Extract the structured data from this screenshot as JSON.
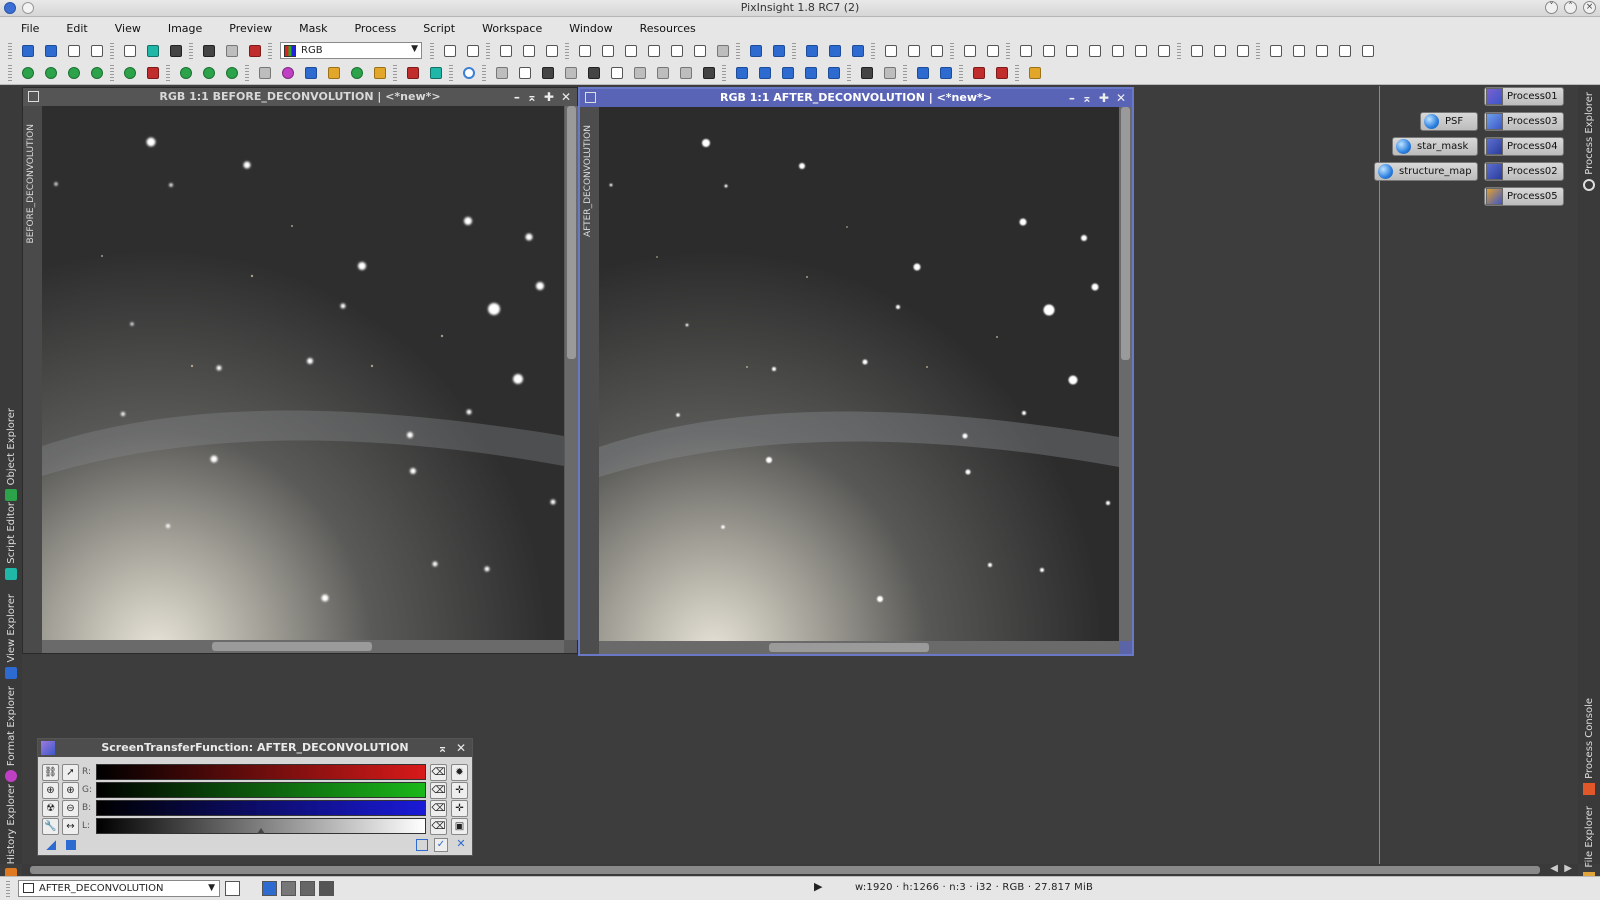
{
  "window": {
    "title": "PixInsight 1.8 RC7 (2)"
  },
  "menu": [
    "File",
    "Edit",
    "View",
    "Image",
    "Preview",
    "Mask",
    "Process",
    "Script",
    "Workspace",
    "Window",
    "Resources"
  ],
  "toolbar": {
    "channel_combo_value": "RGB"
  },
  "left_tabs": [
    "Object Explorer",
    "Script Editor",
    "View Explorer",
    "Format Explorer",
    "History Explorer"
  ],
  "right_tabs": [
    "Process Explorer",
    "Process Console",
    "File Explorer"
  ],
  "image_windows": [
    {
      "title": "RGB 1:1 BEFORE_DECONVOLUTION | <*new*>",
      "side_label": "BEFORE_DECONVOLUTION",
      "active": false
    },
    {
      "title": "RGB 1:1 AFTER_DECONVOLUTION | <*new*>",
      "side_label": "AFTER_DECONVOLUTION",
      "active": true
    }
  ],
  "process_icons": {
    "right_column": [
      "Process01",
      "Process03",
      "Process04",
      "Process02",
      "Process05"
    ],
    "image_icons": [
      "PSF",
      "star_mask",
      "structure_map"
    ]
  },
  "stf_panel": {
    "title": "ScreenTransferFunction: AFTER_DECONVOLUTION",
    "channels": [
      {
        "label": "R:",
        "color": "#d81a1a"
      },
      {
        "label": "G:",
        "color": "#1ab81a"
      },
      {
        "label": "B:",
        "color": "#1a1ad8"
      },
      {
        "label": "L:",
        "color": "#ffffff"
      }
    ],
    "luminance_midtone": 0.5
  },
  "statusbar": {
    "view_combo_value": "AFTER_DECONVOLUTION",
    "image_info": "w:1920 · h:1266 · n:3 · i32 · RGB · 27.817 MiB"
  },
  "colors": {
    "active_window": "#5a64b6",
    "workspace": "#3d3d3d"
  }
}
